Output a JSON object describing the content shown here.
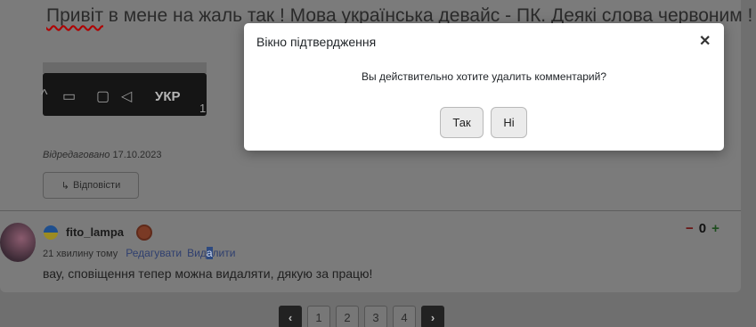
{
  "post": {
    "headline_err": "Привіт",
    "headline_rest": " в мене на жаль так ! Мова українська девайс - ПК. Деякі слова червоним !",
    "taskbar": {
      "language": "УКР",
      "number": "1"
    },
    "edited_label": "Відредаговано",
    "edited_date": "17.10.2023",
    "reply_label": "Відповісти"
  },
  "comment": {
    "username": "fito_lampa",
    "time": "21 хвилину тому",
    "edit_link": "Редагувати",
    "delete_link_a": "Вид",
    "delete_link_sel": "а",
    "delete_link_b": "лити",
    "text": "вау, сповіщення тепер можна видаляти, дякую за працю!",
    "vote_minus": "−",
    "vote_score": "0",
    "vote_plus": "+"
  },
  "pagination": {
    "prev": "‹",
    "pages": [
      "1",
      "2",
      "3",
      "4"
    ],
    "next": "›"
  },
  "dialog": {
    "title": "Вікно підтвердження",
    "close": "✕",
    "message": "Вы действительно хотите удалить комментарий?",
    "yes_label": "Так",
    "no_label": "Ні"
  },
  "colors": {
    "overlay": "#6f6f6f",
    "modal_bg": "#ffffff",
    "flag_blue": "#1f4f8e",
    "flag_yellow": "#9c8b22"
  }
}
